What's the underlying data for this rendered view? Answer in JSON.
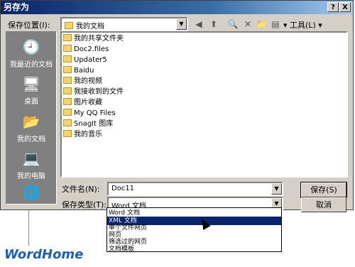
{
  "window": {
    "title": "另存为",
    "help_btn": "?",
    "close_btn": "X"
  },
  "location": {
    "label": "保存位置(I):",
    "value": "我的文档"
  },
  "toolbar": {
    "tools_label": "工具(L)"
  },
  "places": [
    {
      "label": "我最近的文档",
      "icon": "recent-docs-icon"
    },
    {
      "label": "桌面",
      "icon": "desktop-icon"
    },
    {
      "label": "我的文档",
      "icon": "my-documents-icon"
    },
    {
      "label": "我的电脑",
      "icon": "my-computer-icon"
    }
  ],
  "files": [
    "我的共享文件夹",
    "Doc2.files",
    "Updater5",
    "Baidu",
    "我的视频",
    "我接收到的文件",
    "图片收藏",
    "My QQ Files",
    "SnagIt 图库",
    "我的音乐"
  ],
  "filename": {
    "label": "文件名(N):",
    "value": "Doc11"
  },
  "filetype": {
    "label": "保存类型(T):",
    "value": "Word 文档",
    "options": [
      "Word 文档",
      "XML 文档",
      "单个文件网页",
      "网页",
      "筛选过的网页",
      "文档模板"
    ],
    "selected_index": 1
  },
  "buttons": {
    "save": "保存(S)",
    "cancel": "取消"
  },
  "watermark": "WordHome"
}
